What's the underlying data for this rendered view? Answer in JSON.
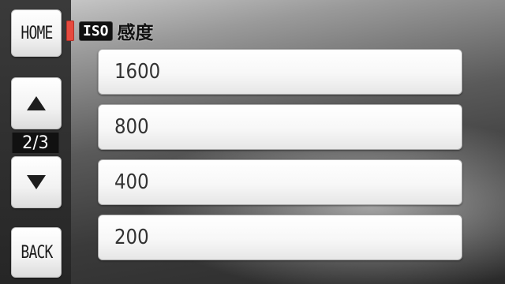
{
  "header": {
    "iso_badge": "ISO",
    "title": "感度",
    "marker_color": "#e64a3f"
  },
  "nav": {
    "home_label": "HOME",
    "up_icon": "triangle-up-icon",
    "page_indicator": "2/3",
    "down_icon": "triangle-down-icon",
    "back_label": "BACK"
  },
  "options": [
    {
      "label": "1600"
    },
    {
      "label": "800"
    },
    {
      "label": "400"
    },
    {
      "label": "200"
    }
  ]
}
